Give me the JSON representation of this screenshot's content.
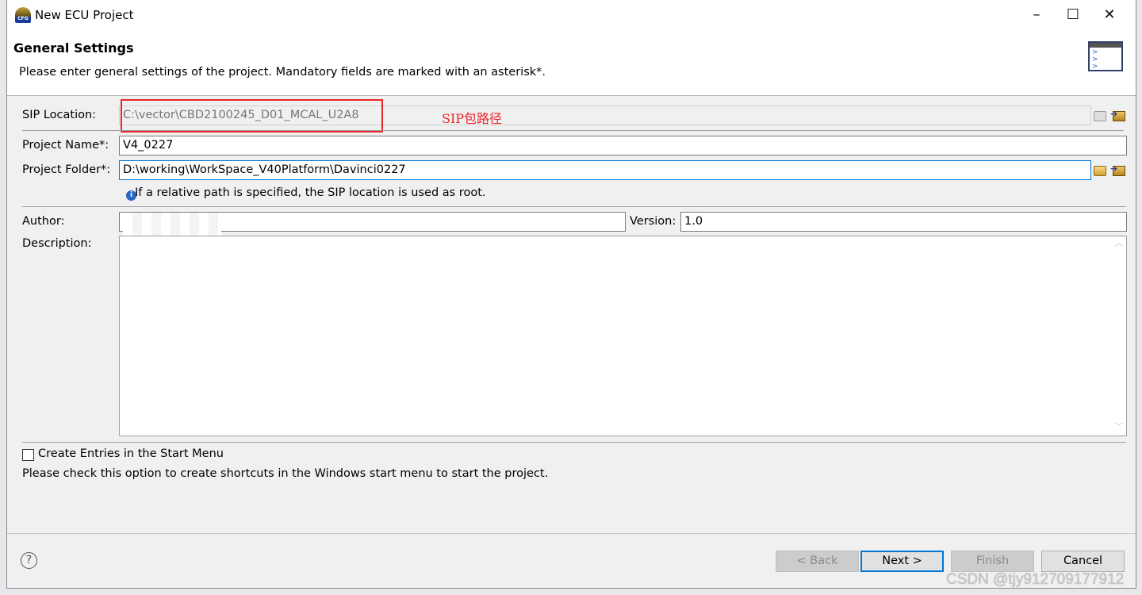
{
  "window": {
    "title": "New ECU Project",
    "app_icon_text": "CFG"
  },
  "header": {
    "title": "General Settings",
    "description": "Please enter general settings of the project. Mandatory fields are marked with an asterisk*."
  },
  "form": {
    "sip_location": {
      "label": "SIP Location:",
      "value": "C:\\vector\\CBD2100245_D01_MCAL_U2A8",
      "annotation": "SIP包路径"
    },
    "project_name": {
      "label": "Project Name*:",
      "value": "V4_0227"
    },
    "project_folder": {
      "label": "Project Folder*:",
      "value": "D:\\working\\WorkSpace_V40Platform\\Davinci0227"
    },
    "hint": "If a relative path is specified, the SIP location is used as root.",
    "author": {
      "label": "Author:",
      "value": ""
    },
    "version": {
      "label": "Version:",
      "value": "1.0"
    },
    "description": {
      "label": "Description:",
      "value": ""
    },
    "start_menu": {
      "label": "Create Entries in the Start Menu",
      "checked": false,
      "hint": "Please check this option to create shortcuts in the Windows start menu to start the project."
    }
  },
  "buttons": {
    "back": "< Back",
    "next": "Next >",
    "finish": "Finish",
    "cancel": "Cancel",
    "help": "?"
  },
  "watermark": "CSDN @tjy912709177912",
  "colors": {
    "accent": "#0078d7",
    "annotation": "#e8262a"
  }
}
